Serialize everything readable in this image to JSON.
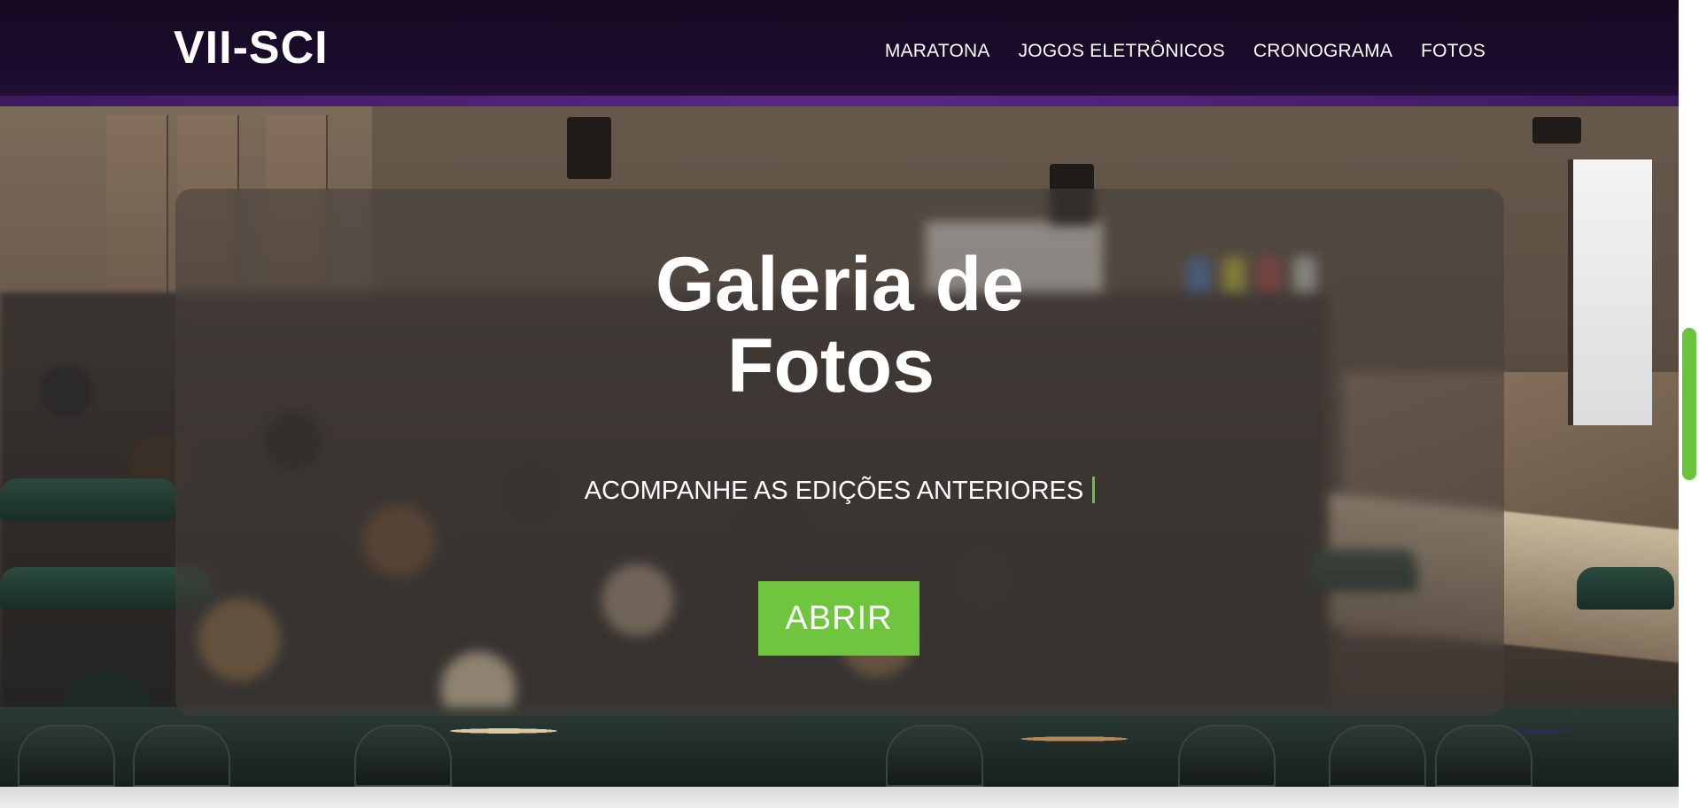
{
  "header": {
    "logo_text": "VII-SCI",
    "nav": [
      {
        "label": "MARATONA"
      },
      {
        "label": "JOGOS ELETRÔNICOS"
      },
      {
        "label": "CRONOGRAMA"
      },
      {
        "label": "FOTOS"
      }
    ]
  },
  "hero": {
    "title_line1": "Galeria de",
    "title_line2": "Fotos",
    "subtitle": "ACOMPANHE AS EDIÇÕES ANTERIORES",
    "button_label": "ABRIR"
  },
  "colors": {
    "accent": "#6fc53d",
    "header_bg": "#1c0c2e",
    "header_strip": "#5a2785"
  },
  "scrollbar": {
    "position": 0.45
  }
}
